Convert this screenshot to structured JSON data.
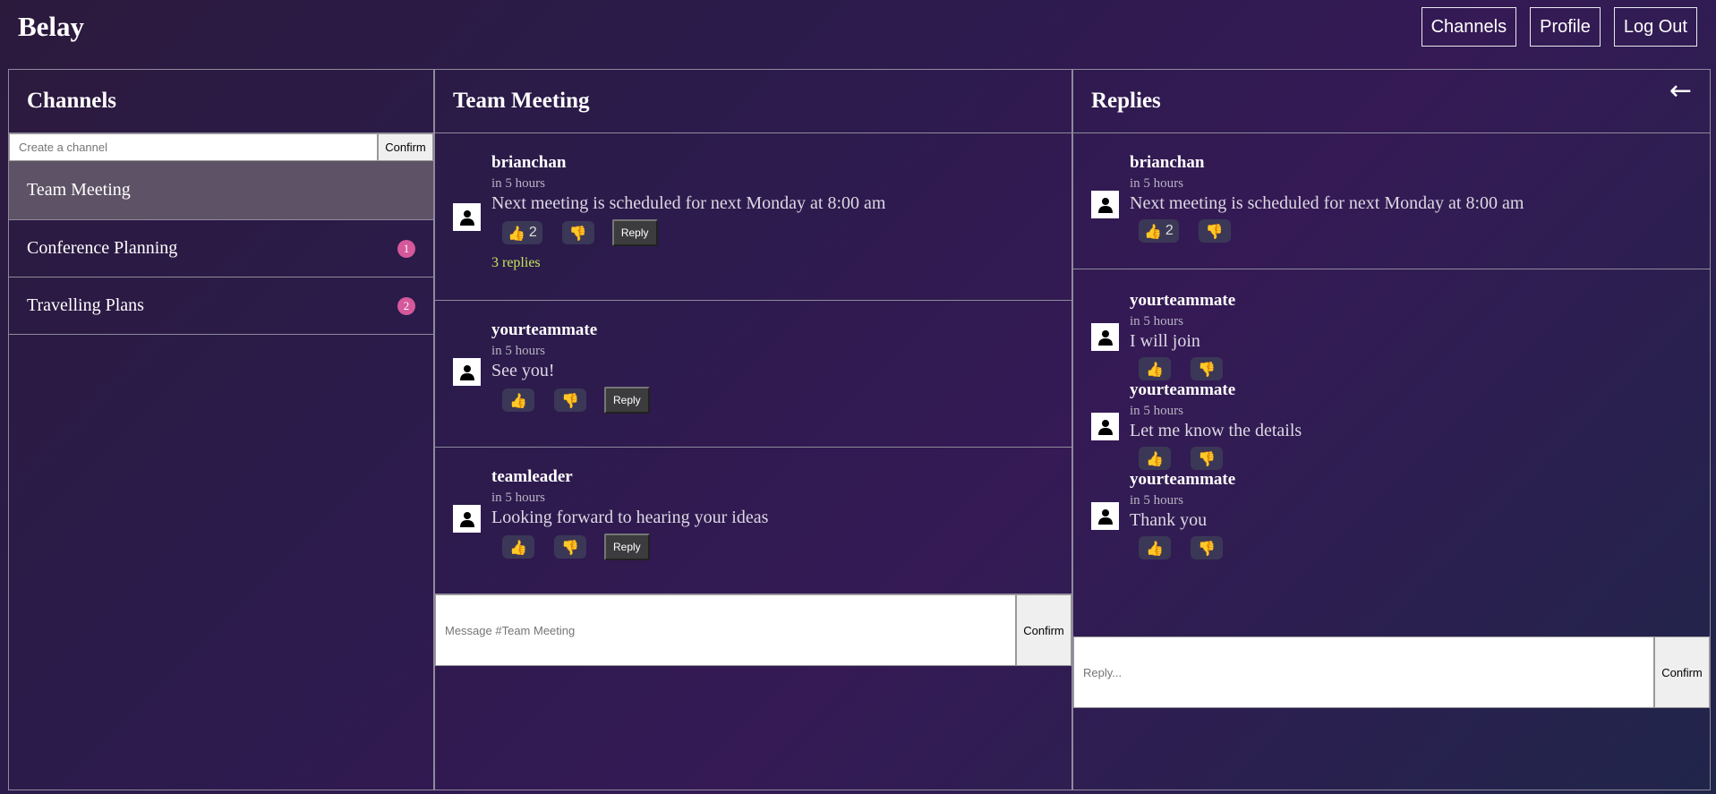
{
  "app": {
    "title": "Belay"
  },
  "nav": {
    "channels": "Channels",
    "profile": "Profile",
    "logout": "Log Out"
  },
  "channels_panel": {
    "title": "Channels",
    "create_placeholder": "Create a channel",
    "create_button": "Confirm",
    "items": [
      {
        "name": "Team Meeting",
        "badge": ""
      },
      {
        "name": "Conference Planning",
        "badge": "1"
      },
      {
        "name": "Travelling Plans",
        "badge": "2"
      }
    ]
  },
  "thread": {
    "title": "Team Meeting",
    "messages": [
      {
        "author": "brianchan",
        "time": "in 5 hours",
        "text": "Next meeting is scheduled for next Monday at 8:00 am",
        "likes": "2",
        "reply_label": "Reply",
        "replies_link": "3 replies"
      },
      {
        "author": "yourteammate",
        "time": "in 5 hours",
        "text": "See you!",
        "reply_label": "Reply"
      },
      {
        "author": "teamleader",
        "time": "in 5 hours",
        "text": "Looking forward to hearing your ideas",
        "reply_label": "Reply"
      }
    ],
    "composer_placeholder": "Message #Team Meeting",
    "composer_button": "Confirm"
  },
  "replies": {
    "title": "Replies",
    "back_icon": "←",
    "parent": {
      "author": "brianchan",
      "time": "in 5 hours",
      "text": "Next meeting is scheduled for next Monday at 8:00 am",
      "likes": "2"
    },
    "items": [
      {
        "author": "yourteammate",
        "time": "in 5 hours",
        "text": "I will join"
      },
      {
        "author": "yourteammate",
        "time": "in 5 hours",
        "text": "Let me know the details"
      },
      {
        "author": "yourteammate",
        "time": "in 5 hours",
        "text": "Thank you"
      }
    ],
    "composer_placeholder": "Reply...",
    "composer_button": "Confirm"
  },
  "icons": {
    "like": "👍",
    "dislike": "👎",
    "avatar": "user-silhouette-icon"
  },
  "colors": {
    "badge": "#d5589b",
    "replies_link": "#c6e35a",
    "active_channel": "#5e5366"
  }
}
